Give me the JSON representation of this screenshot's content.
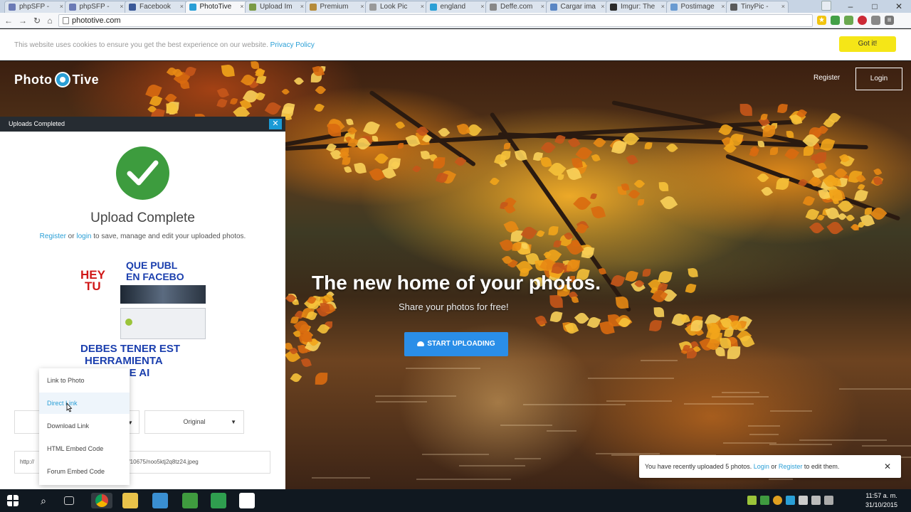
{
  "browser": {
    "tabs": [
      {
        "label": "phpSFP - ",
        "favicon_color": "#6b7ab5"
      },
      {
        "label": "phpSFP - ",
        "favicon_color": "#6b7ab5"
      },
      {
        "label": "Facebook",
        "favicon_color": "#3b5998"
      },
      {
        "label": "PhotoTive",
        "favicon_color": "#2a9fd6"
      },
      {
        "label": "Upload Im",
        "favicon_color": "#7a9a45"
      },
      {
        "label": "Premium",
        "favicon_color": "#b58b3a"
      },
      {
        "label": "Look Pic",
        "favicon_color": "#999999"
      },
      {
        "label": "england",
        "favicon_color": "#2a9fd6"
      },
      {
        "label": "Deffe.com",
        "favicon_color": "#888888"
      },
      {
        "label": "Cargar ima",
        "favicon_color": "#5a86c4"
      },
      {
        "label": "Imgur: The",
        "favicon_color": "#2b2b2b"
      },
      {
        "label": "Postimage",
        "favicon_color": "#6a9bd1"
      },
      {
        "label": "TinyPic - ",
        "favicon_color": "#5a5a5a"
      }
    ],
    "active_tab_index": 3,
    "url": "phototive.com"
  },
  "cookie": {
    "text": "This website uses cookies to ensure you get the best experience on our website.",
    "link": "Privacy Policy",
    "button": "Got it!"
  },
  "header": {
    "logo_left": "Photo",
    "logo_right": "Tive",
    "register": "Register",
    "login": "Login"
  },
  "hero": {
    "title": "The new home of your photos.",
    "subtitle": "Share your photos for free!",
    "button": "START UPLOADING"
  },
  "modal": {
    "header": "Uploads Completed",
    "close": "✕",
    "title": "Upload Complete",
    "register_link": "Register",
    "or": " or ",
    "login_link": "login",
    "rest": " to save, manage and edit your uploaded photos.",
    "thumbnail_lines": [
      "QUE PUBL",
      "EN FACEBO",
      "HEY",
      "TU",
      "DEBES TENER EST",
      "HERRAMIENTA",
      "ACE DE AI"
    ],
    "size_select": "Original",
    "link_value_start": "http://",
    "link_value_end": "h/10675/noo5ktj2q8tz24.jpeg",
    "dropdown": [
      "Link to Photo",
      "Direct Link",
      "Download Link",
      "HTML Embed Code",
      "Forum Embed Code"
    ],
    "dropdown_hover_index": 1
  },
  "toast": {
    "text": "You have recently uploaded 5 photos. ",
    "login": "Login",
    "or": " or ",
    "register": "Register",
    "end": " to edit them.",
    "close": "✕"
  },
  "taskbar": {
    "time": "11:57 a. m.",
    "date": "31/10/2015"
  },
  "colors": {
    "accent": "#2a9fd6",
    "success": "#3d9c3e",
    "cookie_button": "#f5e617",
    "hero_button": "#2a8ee8"
  }
}
